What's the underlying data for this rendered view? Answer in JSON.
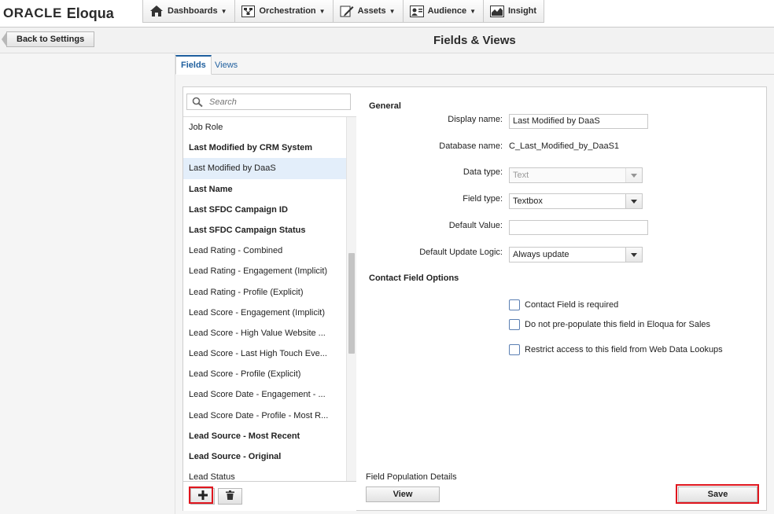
{
  "brand": {
    "company": "ORACLE",
    "product": "Eloqua"
  },
  "nav": {
    "items": [
      {
        "label": "Dashboards",
        "icon": "home-icon",
        "has_caret": true
      },
      {
        "label": "Orchestration",
        "icon": "orchestration-icon",
        "has_caret": true
      },
      {
        "label": "Assets",
        "icon": "pencil-icon",
        "has_caret": true
      },
      {
        "label": "Audience",
        "icon": "audience-icon",
        "has_caret": true
      },
      {
        "label": "Insight",
        "icon": "chart-icon",
        "has_caret": false
      }
    ]
  },
  "subheader": {
    "back_label": "Back to Settings",
    "title": "Fields & Views"
  },
  "tabs": [
    {
      "label": "Fields",
      "active": true
    },
    {
      "label": "Views",
      "active": false
    }
  ],
  "search": {
    "placeholder": "Search"
  },
  "fields_list": [
    {
      "label": "Job Role",
      "bold": false
    },
    {
      "label": "Last Modified by CRM System",
      "bold": true
    },
    {
      "label": "Last Modified by DaaS",
      "bold": false,
      "selected": true
    },
    {
      "label": "Last Name",
      "bold": true
    },
    {
      "label": "Last SFDC Campaign ID",
      "bold": true
    },
    {
      "label": "Last SFDC Campaign Status",
      "bold": true
    },
    {
      "label": "Lead Rating - Combined",
      "bold": false
    },
    {
      "label": "Lead Rating - Engagement (Implicit)",
      "bold": false
    },
    {
      "label": "Lead Rating - Profile (Explicit)",
      "bold": false
    },
    {
      "label": "Lead Score - Engagement (Implicit)",
      "bold": false
    },
    {
      "label": "Lead Score - High Value Website ...",
      "bold": false
    },
    {
      "label": "Lead Score - Last High Touch Eve...",
      "bold": false
    },
    {
      "label": "Lead Score - Profile (Explicit)",
      "bold": false
    },
    {
      "label": "Lead Score Date - Engagement - ...",
      "bold": false
    },
    {
      "label": "Lead Score Date - Profile - Most R...",
      "bold": false
    },
    {
      "label": "Lead Source - Most Recent",
      "bold": true
    },
    {
      "label": "Lead Source - Original",
      "bold": true
    },
    {
      "label": "Lead Status",
      "bold": false
    }
  ],
  "general": {
    "header": "General",
    "display_name": {
      "label": "Display name:",
      "value": "Last Modified by DaaS"
    },
    "database_name": {
      "label": "Database name:",
      "value": "C_Last_Modified_by_DaaS1"
    },
    "data_type": {
      "label": "Data type:",
      "value": "Text",
      "disabled": true
    },
    "field_type": {
      "label": "Field type:",
      "value": "Textbox"
    },
    "default_value": {
      "label": "Default Value:",
      "value": ""
    },
    "default_update_logic": {
      "label": "Default Update Logic:",
      "value": "Always update"
    }
  },
  "contact_options": {
    "header": "Contact Field Options",
    "items": [
      {
        "label": "Contact Field is required",
        "checked": false
      },
      {
        "label": "Do not pre-populate this field in Eloqua for Sales",
        "checked": false
      },
      {
        "label": "Restrict access to this field from Web Data Lookups",
        "checked": false
      }
    ]
  },
  "population": {
    "label": "Field Population Details",
    "view_label": "View"
  },
  "actions": {
    "save_label": "Save"
  },
  "colors": {
    "accent": "#1f5f9e",
    "highlight": "#e0161e",
    "selected_row": "#e3eefa"
  }
}
